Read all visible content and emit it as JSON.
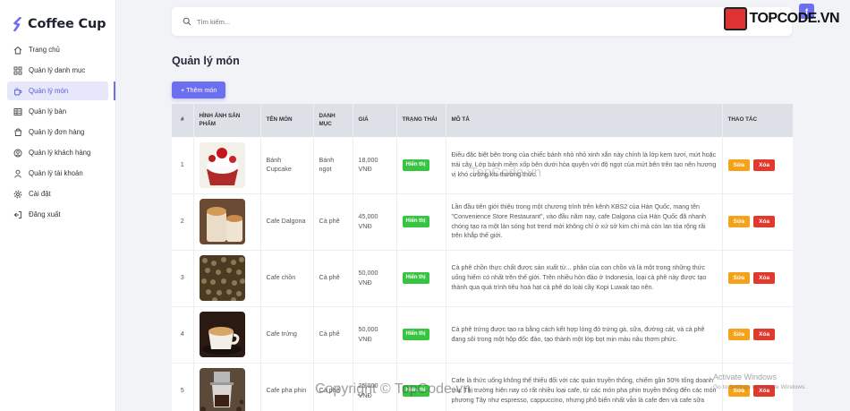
{
  "brand": {
    "name": "Coffee Cup"
  },
  "sidebar": {
    "items": [
      {
        "label": "Trang chủ",
        "icon": "home-icon"
      },
      {
        "label": "Quản lý danh mục",
        "icon": "grid-icon"
      },
      {
        "label": "Quản lý món",
        "icon": "cup-icon",
        "active": true
      },
      {
        "label": "Quản lý bàn",
        "icon": "table-icon"
      },
      {
        "label": "Quản lý đơn hàng",
        "icon": "cart-icon"
      },
      {
        "label": "Quản lý khách hàng",
        "icon": "user-circle-icon"
      },
      {
        "label": "Quản lý tài khoản",
        "icon": "user-icon"
      },
      {
        "label": "Cài đặt",
        "icon": "gear-icon"
      },
      {
        "label": "Đăng xuất",
        "icon": "logout-icon"
      }
    ]
  },
  "search": {
    "placeholder": "Tìm kiếm..."
  },
  "page": {
    "title": "Quản lý món",
    "add_label": "+ Thêm món"
  },
  "table": {
    "headers": [
      "#",
      "HÌNH ẢNH SẢN PHẨM",
      "TÊN MÓN",
      "DANH MỤC",
      "GIÁ",
      "TRẠNG THÁI",
      "MÔ TẢ",
      "THAO TÁC"
    ],
    "rows": [
      {
        "index": "1",
        "name": "Bánh Cupcake",
        "category": "Bánh ngọt",
        "price": "18,000 VNĐ",
        "status": "Hiển thị",
        "description": "Điều đặc biệt bên trong của chiếc bánh nhỏ nhỏ xinh xắn này chính là lớp kem tươi, mứt hoặc trái cây. Lớp bánh mềm xốp bên dưới hòa quyện với độ ngọt của mứt bên trên tạo nên hương vị khó cưỡng khi thưởng thức."
      },
      {
        "index": "2",
        "name": "Cafe Dalgona",
        "category": "Cà phê",
        "price": "45,000 VNĐ",
        "status": "Hiển thị",
        "description": "Lần đầu tiên giới thiệu trong một chương trình trên kênh KBS2 của Hàn Quốc, mang tên \"Convenience Store Restaurant\", vào đầu năm nay, cafe Dalgona của Hàn Quốc đã nhanh chóng tạo ra một làn sóng hot trend mới không chỉ ở xứ sở kim chi mà còn lan tỏa rộng rãi trên khắp thế giới."
      },
      {
        "index": "3",
        "name": "Cafe chồn",
        "category": "Cà phê",
        "price": "50,000 VNĐ",
        "status": "Hiển thị",
        "description": "Cà phê chồn thực chất được sản xuất từ... phân của con chồn và là một trong những thức uống hiếm có nhất trên thế giới. Trên nhiều hòn đảo ở Indonesia, loại cà phê này được tạo thành qua quá trình tiêu hoá hạt cà phê do loài cầy Kopi Luwak tạo nên."
      },
      {
        "index": "4",
        "name": "Cafe trứng",
        "category": "Cà phê",
        "price": "50,000 VNĐ",
        "status": "Hiển thị",
        "description": "Cà phê trứng được tạo ra bằng cách kết hợp lòng đỏ trứng gà, sữa, đường cát, và cà phê đang sôi trong một hộp đốc đảo, tạo thành một lớp bọt mịn màu nâu thơm phức."
      },
      {
        "index": "5",
        "name": "Cafe pha phin",
        "category": "Cà phê",
        "price": "25,000 VNĐ",
        "status": "Hiển thị",
        "description": "Cafe là thức uống không thể thiếu đối với các quán truyền thống, chiếm gần 50% tổng doanh thu. Thị trường hiện nay có rất nhiều loại cafe, từ các món pha phin truyền thống đến các món phương Tây như espresso, cappuccino, nhưng phổ biến nhất vẫn là cafe đen và cafe sữa"
      }
    ],
    "edit_label": "Sửa",
    "delete_label": "Xóa"
  },
  "watermarks": {
    "logo_text": "TOPCODE.VN",
    "mid_text": "TopCode.vn",
    "bottom_text": "Copyright © TopCode.vn",
    "activate_title": "Activate Windows",
    "activate_sub": "Go to Settings to activate Windows."
  },
  "colors": {
    "accent": "#6c6ff0",
    "status": "#37c441",
    "edit": "#f4a21a",
    "delete": "#e2392d"
  }
}
